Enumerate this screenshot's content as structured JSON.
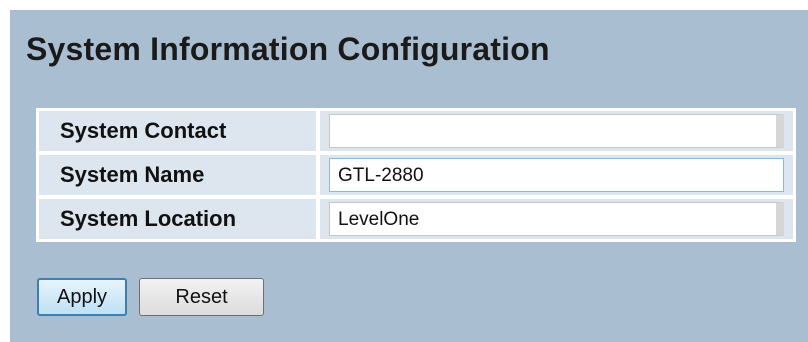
{
  "page": {
    "title": "System Information Configuration"
  },
  "form": {
    "rows": [
      {
        "label": "System Contact",
        "value": ""
      },
      {
        "label": "System Name",
        "value": "GTL-2880"
      },
      {
        "label": "System Location",
        "value": "LevelOne"
      }
    ]
  },
  "buttons": {
    "apply_label": "Apply",
    "reset_label": "Reset"
  },
  "colors": {
    "panel_background": "#a9bfd1",
    "cell_background": "#dde5ee",
    "primary_button_border": "#3c7fb1"
  }
}
